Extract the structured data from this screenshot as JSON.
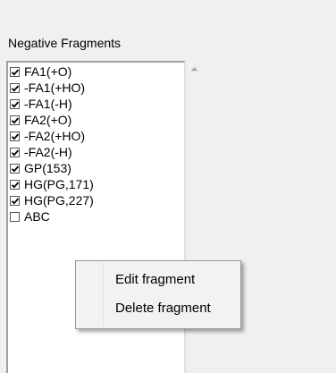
{
  "panel": {
    "title": "Negative Fragments"
  },
  "fragments": [
    {
      "label": "FA1(+O)",
      "checked": true
    },
    {
      "label": "-FA1(+HO)",
      "checked": true
    },
    {
      "label": "-FA1(-H)",
      "checked": true
    },
    {
      "label": "FA2(+O)",
      "checked": true
    },
    {
      "label": "-FA2(+HO)",
      "checked": true
    },
    {
      "label": "-FA2(-H)",
      "checked": true
    },
    {
      "label": "GP(153)",
      "checked": true
    },
    {
      "label": "HG(PG,171)",
      "checked": true
    },
    {
      "label": "HG(PG,227)",
      "checked": true
    },
    {
      "label": "ABC",
      "checked": false
    }
  ],
  "context_menu": {
    "edit_label": "Edit fragment",
    "delete_label": "Delete fragment"
  },
  "icons": {
    "scroll_up": "scroll-up-arrow-icon",
    "check": "checkmark-icon"
  }
}
